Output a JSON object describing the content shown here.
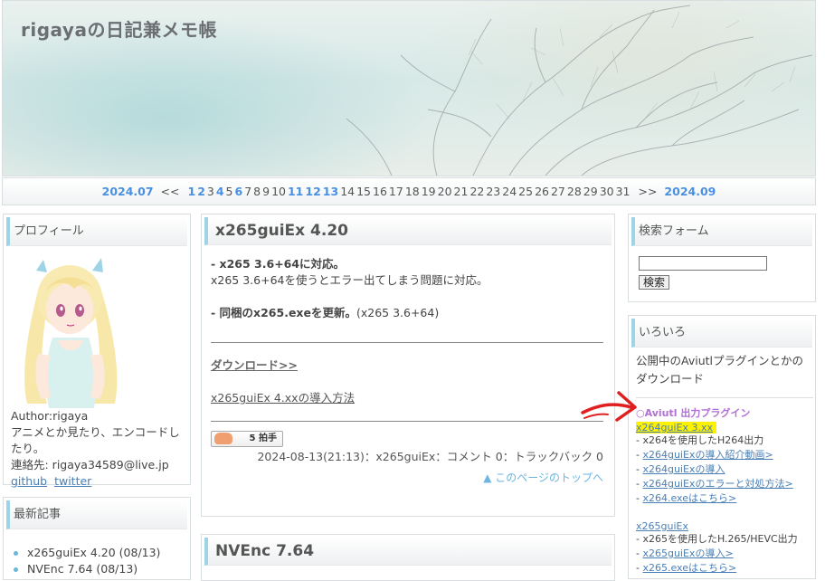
{
  "site": {
    "title": "rigayaの日記兼メモ帳"
  },
  "calendar": {
    "prev_month": "2024.07",
    "prev_arrow": "<<",
    "days": [
      {
        "d": "1",
        "linked": true
      },
      {
        "d": "2",
        "linked": true
      },
      {
        "d": "3",
        "linked": false
      },
      {
        "d": "4",
        "linked": true
      },
      {
        "d": "5",
        "linked": false
      },
      {
        "d": "6",
        "linked": true
      },
      {
        "d": "7",
        "linked": false
      },
      {
        "d": "8",
        "linked": false
      },
      {
        "d": "9",
        "linked": false
      },
      {
        "d": "10",
        "linked": false
      },
      {
        "d": "11",
        "linked": true
      },
      {
        "d": "12",
        "linked": true
      },
      {
        "d": "13",
        "linked": true
      },
      {
        "d": "14",
        "linked": false
      },
      {
        "d": "15",
        "linked": false
      },
      {
        "d": "16",
        "linked": false
      },
      {
        "d": "17",
        "linked": false
      },
      {
        "d": "18",
        "linked": false
      },
      {
        "d": "19",
        "linked": false
      },
      {
        "d": "20",
        "linked": false
      },
      {
        "d": "21",
        "linked": false
      },
      {
        "d": "22",
        "linked": false
      },
      {
        "d": "23",
        "linked": false
      },
      {
        "d": "24",
        "linked": false
      },
      {
        "d": "25",
        "linked": false
      },
      {
        "d": "26",
        "linked": false
      },
      {
        "d": "27",
        "linked": false
      },
      {
        "d": "28",
        "linked": false
      },
      {
        "d": "29",
        "linked": false
      },
      {
        "d": "30",
        "linked": false
      },
      {
        "d": "31",
        "linked": false
      }
    ],
    "next_arrow": ">>",
    "next_month": "2024.09"
  },
  "profile": {
    "title": "プロフィール",
    "author": "Author:rigaya",
    "bio": "アニメとか見たり、エンコードしたり。",
    "contact": "連絡先: rigaya34589@live.jp",
    "github": "github",
    "twitter": "twitter"
  },
  "latest": {
    "title": "最新記事",
    "items": [
      "x265guiEx 4.20 (08/13)",
      "NVEnc 7.64 (08/13)"
    ]
  },
  "article": {
    "title": "x265guiEx 4.20",
    "line1_bold": "- x265 3.6+64に対応。",
    "line1_body": "x265 3.6+64を使うとエラー出てしまう問題に対応。",
    "line2_bold": "- 同梱のx265.exeを更新。",
    "line2_body": "(x265 3.6+64)",
    "download": "ダウンロード>>",
    "guide": "x265guiEx 4.xxの導入方法",
    "clap_count": "5",
    "clap_label": "拍手",
    "meta": "2024-08-13(21:13)：x265guiEx：コメント 0：トラックバック 0",
    "pagetop": "▲ このページのトップへ"
  },
  "article2": {
    "title": "NVEnc 7.64"
  },
  "search": {
    "title": "検索フォーム",
    "input_value": "",
    "button": "検索"
  },
  "iroiro": {
    "title": "いろいろ",
    "intro": "公開中のAviutlプラグインとかのダウンロード",
    "section": "○Aviutl 出力プラグイン",
    "x264_link": "x264guiEx 3.xx",
    "x264_items": [
      "- x264を使用したH264出力",
      "- x264guiExの導入紹介動画>",
      "- x264guiExの導入",
      "- x264guiExのエラーと対処方法>",
      "- x264.exeはこちら>"
    ],
    "x265_link": "x265guiEx",
    "x265_items": [
      "- x265を使用したH.265/HEVC出力",
      "- x265guiExの導入>",
      "- x265.exeはこちら>"
    ]
  },
  "colors": {
    "accent": "#4a90e2",
    "link": "#4a7fb5",
    "highlight": "#fff200",
    "annotation": "#e02020",
    "title_bar": "#9fd3e6"
  }
}
